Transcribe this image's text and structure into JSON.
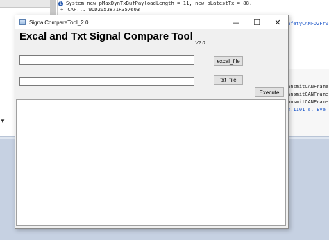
{
  "background": {
    "console_lines": [
      "System  new pMaxDynTxBufPayloadLength = 11, new pLatestTx = 88.",
      "CAP...      WDD2053871F357603"
    ],
    "right_top_link": "afetyCANFD2Fr0:",
    "right_lines": [
      "ansmitCANFrame",
      "ansmitCANFrame",
      "ansmitCANFrame",
      "3.1101 s. Eve"
    ]
  },
  "window": {
    "title": "SignalCompareTool_2.0",
    "controls": {
      "minimize": "—",
      "maximize": "☐",
      "close": "✕"
    }
  },
  "app": {
    "heading": "Excal and Txt Signal Compare Tool",
    "version": "V2.0",
    "excal_path": {
      "value": "",
      "placeholder": ""
    },
    "txt_path": {
      "value": "",
      "placeholder": ""
    },
    "excal_button": "excal_file",
    "txt_button": "txt_file",
    "execute_button": "Execute",
    "output_text": ""
  }
}
